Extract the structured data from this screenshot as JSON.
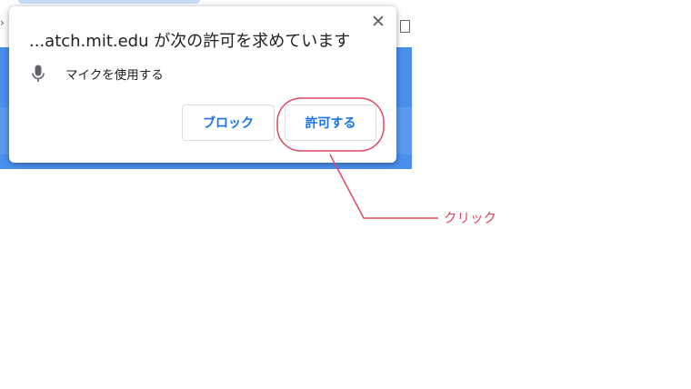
{
  "popup": {
    "title": "...atch.mit.edu が次の許可を求めています",
    "close_glyph": "✕",
    "permission": {
      "icon": "microphone-icon",
      "label": "マイクを使用する"
    },
    "buttons": {
      "block_label": "ブロック",
      "allow_label": "許可する"
    }
  },
  "annotation": {
    "label": "クリック",
    "color": "#e0475f"
  },
  "colors": {
    "button_text": "#1a73e8",
    "browser_blue": "#4a8fee"
  }
}
